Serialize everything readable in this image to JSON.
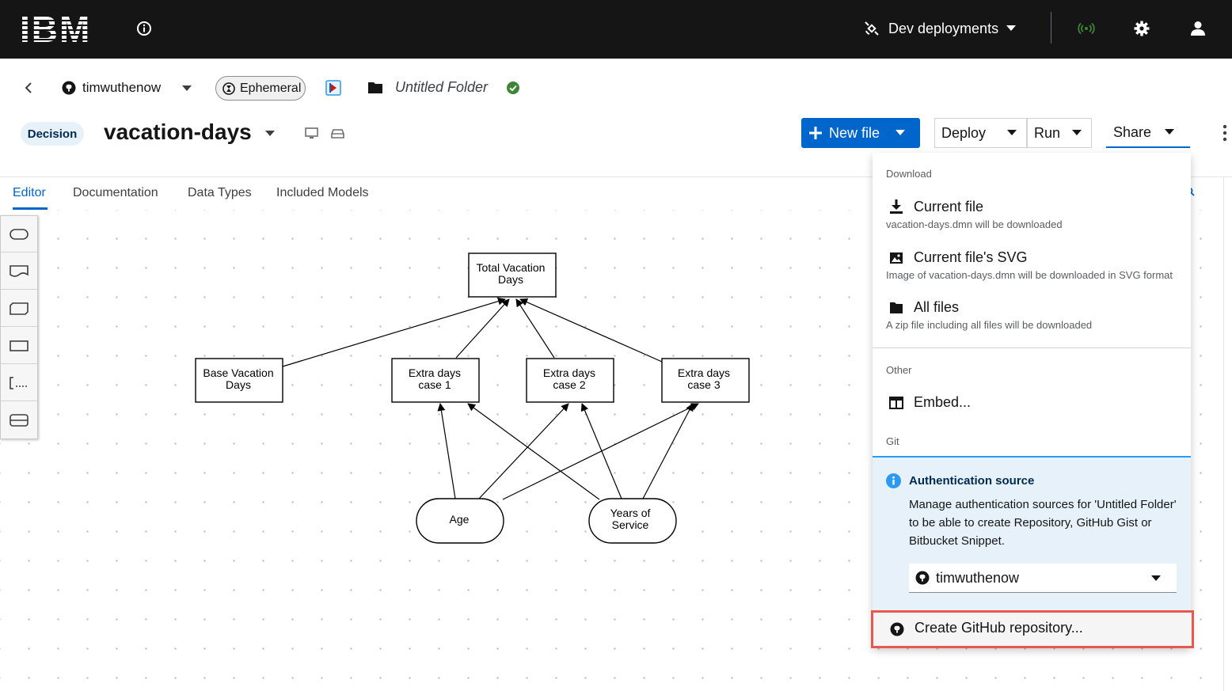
{
  "masthead": {
    "logo_text": "IBM",
    "environment_label": "Dev deployments"
  },
  "breadcrumb": {
    "account_name": "timwuthenow",
    "workspace_chip": "Ephemeral",
    "folder_name": "Untitled Folder"
  },
  "file": {
    "type_badge": "Decision",
    "name": "vacation-days"
  },
  "toolbar": {
    "new_file_label": "New file",
    "deploy_label": "Deploy",
    "run_label": "Run",
    "share_label": "Share"
  },
  "tabs": [
    {
      "label": "Editor",
      "active": true
    },
    {
      "label": "Documentation",
      "active": false
    },
    {
      "label": "Data Types",
      "active": false
    },
    {
      "label": "Included Models",
      "active": false
    }
  ],
  "diagram": {
    "nodes": {
      "total": [
        "Total Vacation",
        "Days"
      ],
      "base": [
        "Base Vacation",
        "Days"
      ],
      "extra1": [
        "Extra days",
        "case 1"
      ],
      "extra2": [
        "Extra days",
        "case 2"
      ],
      "extra3": [
        "Extra days",
        "case 3"
      ],
      "age": [
        "Age"
      ],
      "years": [
        "Years of",
        "Service"
      ]
    }
  },
  "share_menu": {
    "download_group": "Download",
    "current_file": {
      "label": "Current file",
      "description": "vacation-days.dmn will be downloaded"
    },
    "current_svg": {
      "label": "Current file's SVG",
      "description": "Image of vacation-days.dmn will be downloaded in SVG format"
    },
    "all_files": {
      "label": "All files",
      "description": "A zip file including all files will be downloaded"
    },
    "other_group": "Other",
    "embed_label": "Embed...",
    "git_group": "Git",
    "auth_alert": {
      "title": "Authentication source",
      "body": "Manage authentication sources for 'Untitled Folder' to be able to create Repository, GitHub Gist or Bitbucket Snippet.",
      "selected_account": "timwuthenow"
    },
    "create_repo_label": "Create GitHub repository..."
  },
  "colors": {
    "masthead_bg": "#151515",
    "primary_blue": "#0066cc",
    "success_green": "#3e8635",
    "highlight_red": "#e8584f",
    "alert_bg": "#e7f1fa"
  }
}
